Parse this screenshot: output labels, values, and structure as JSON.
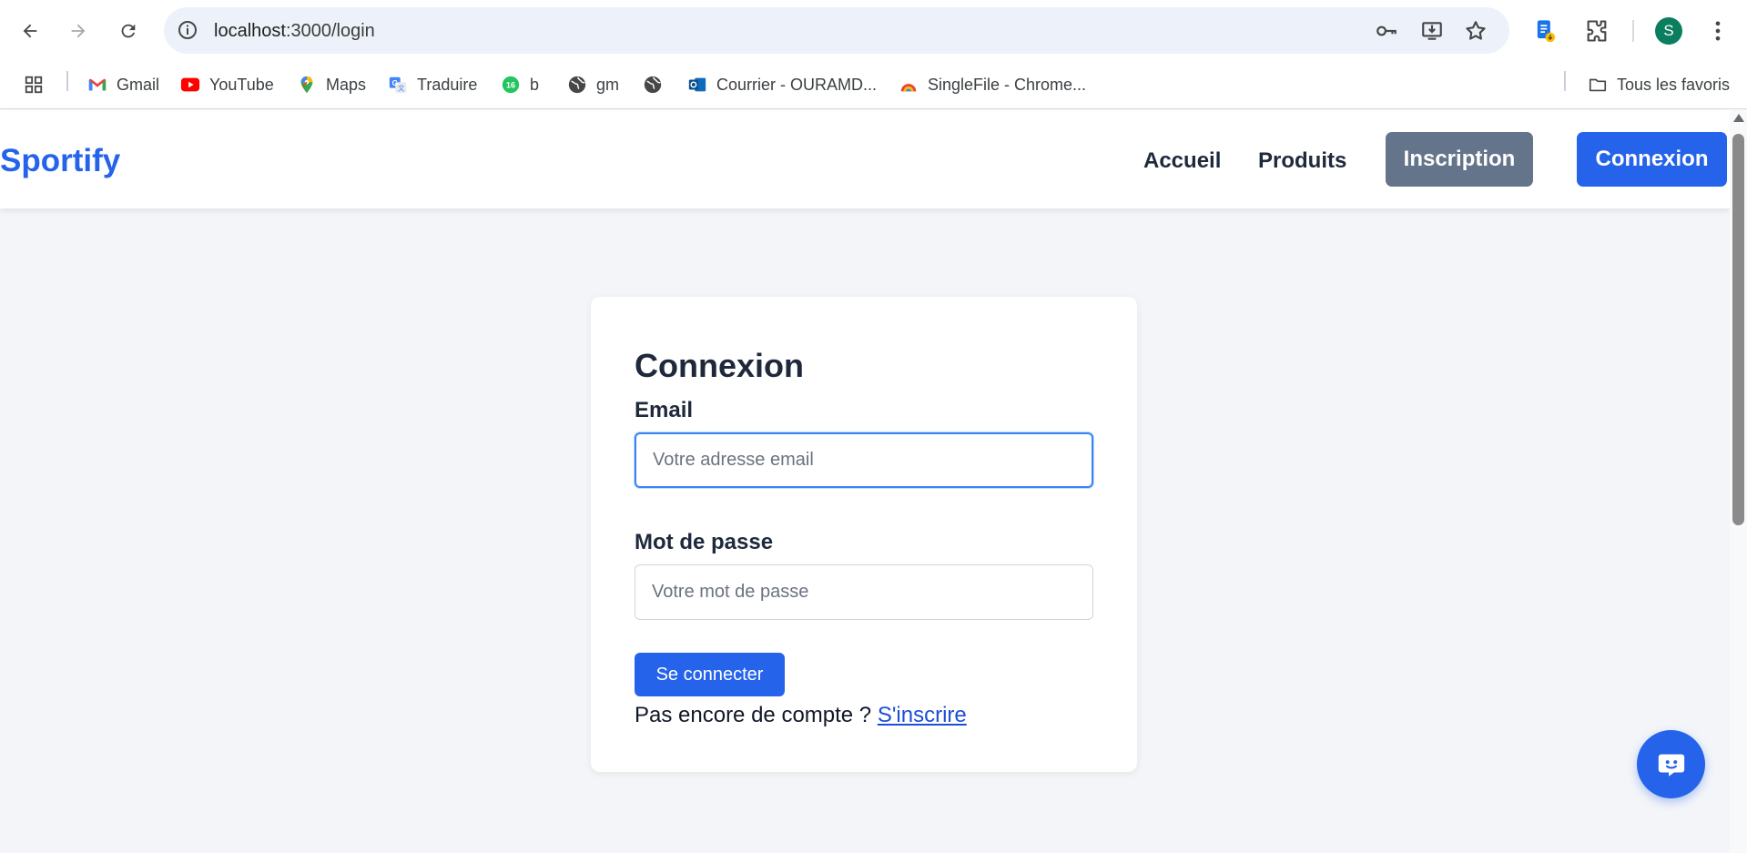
{
  "browser": {
    "url_host": "localhost",
    "url_path": ":3000/login",
    "profile_initial": "S",
    "icons": [
      "back-arrow-icon",
      "forward-arrow-icon",
      "reload-icon",
      "site-info-icon",
      "password-key-icon",
      "install-app-icon",
      "bookmark-star-icon",
      "extension-icon",
      "puzzle-extensions-icon",
      "more-menu-icon"
    ]
  },
  "bookmarks": {
    "items": [
      {
        "label": "Gmail",
        "icon": "gmail-icon"
      },
      {
        "label": "YouTube",
        "icon": "youtube-icon"
      },
      {
        "label": "Maps",
        "icon": "maps-icon"
      },
      {
        "label": "Traduire",
        "icon": "translate-icon"
      },
      {
        "label": "b",
        "icon": "badge-16-icon",
        "badge": "16"
      },
      {
        "label": "gm",
        "icon": "globe-icon"
      },
      {
        "label": "",
        "icon": "globe-icon"
      },
      {
        "label": "Courrier - OURAMD...",
        "icon": "outlook-icon"
      },
      {
        "label": "SingleFile - Chrome...",
        "icon": "singlefile-icon"
      }
    ],
    "all_bookmarks": "Tous les favoris"
  },
  "header": {
    "logo": "Sportify",
    "nav": [
      "Accueil",
      "Produits"
    ],
    "signup_label": "Inscription",
    "login_label": "Connexion"
  },
  "login_form": {
    "title": "Connexion",
    "email_label": "Email",
    "email_placeholder": "Votre adresse email",
    "email_value": "",
    "password_label": "Mot de passe",
    "password_placeholder": "Votre mot de passe",
    "password_value": "",
    "submit_label": "Se connecter",
    "no_account_text": "Pas encore de compte ? ",
    "signup_link": "S'inscrire"
  },
  "colors": {
    "brand": "#2563eb",
    "secondary_button": "#64748b",
    "page_background": "#f3f5f8"
  }
}
